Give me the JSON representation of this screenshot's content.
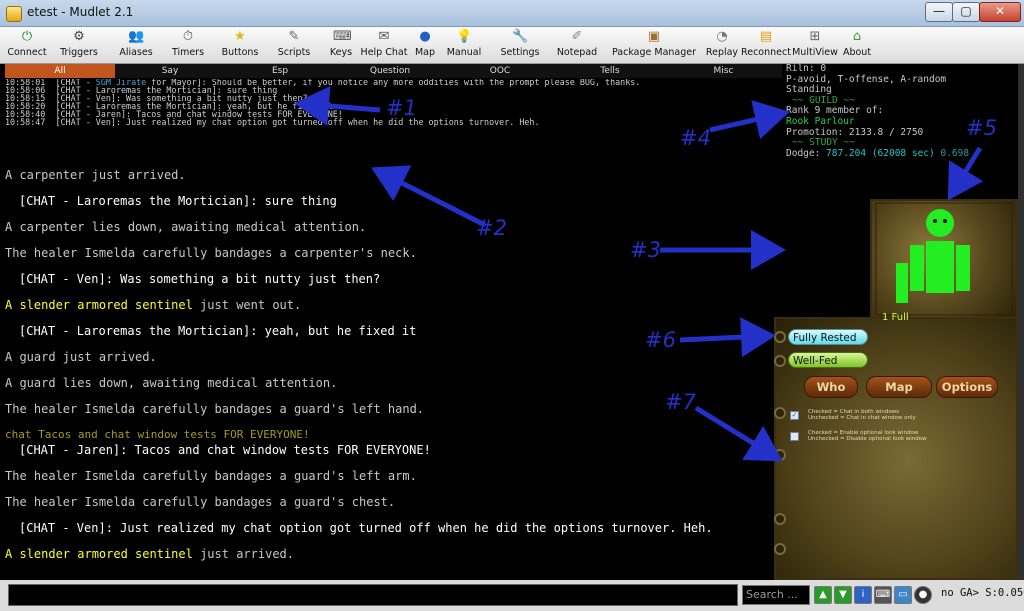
{
  "window": {
    "title": "etest - Mudlet 2.1",
    "controls": [
      "—",
      "▢",
      "✕"
    ]
  },
  "toolbar": [
    {
      "label": "Connect",
      "icon": "connect-icon"
    },
    {
      "label": "Triggers",
      "icon": "triggers-icon"
    },
    {
      "label": "Aliases",
      "icon": "aliases-icon"
    },
    {
      "label": "Timers",
      "icon": "timers-icon"
    },
    {
      "label": "Buttons",
      "icon": "buttons-icon"
    },
    {
      "label": "Scripts",
      "icon": "scripts-icon"
    },
    {
      "label": "Keys",
      "icon": "keys-icon"
    },
    {
      "label": "Help Chat",
      "icon": "help-chat-icon"
    },
    {
      "label": "Map",
      "icon": "map-icon"
    },
    {
      "label": "Manual",
      "icon": "manual-icon"
    },
    {
      "label": "Settings",
      "icon": "settings-icon"
    },
    {
      "label": "Notepad",
      "icon": "notepad-icon"
    },
    {
      "label": "Package Manager",
      "icon": "package-manager-icon"
    },
    {
      "label": "Replay",
      "icon": "replay-icon"
    },
    {
      "label": "Reconnect",
      "icon": "reconnect-icon"
    },
    {
      "label": "MultiView",
      "icon": "multiview-icon"
    },
    {
      "label": "About",
      "icon": "about-icon"
    }
  ],
  "chat_tabs": [
    "All",
    "Say",
    "Esp",
    "Question",
    "OOC",
    "Tells",
    "Misc"
  ],
  "chat_lines": [
    {
      "time": "10:58:01",
      "pre": "[CHAT - ",
      "hl": "SGM Jirate",
      "post": " for Mayor]: Should be better, if you notice any more oddities with the prompt please BUG, thanks."
    },
    {
      "time": "10:58:06",
      "pre": "[CHAT - Laroremas the Mortician]: sure thing",
      "hl": "",
      "post": ""
    },
    {
      "time": "10:58:15",
      "pre": "[CHAT - Ven]: Was something a bit nutty just then?",
      "hl": "",
      "post": ""
    },
    {
      "time": "10:58:20",
      "pre": "[CHAT - Laroremas the Mortician]: yeah, but he fixed it",
      "hl": "",
      "post": ""
    },
    {
      "time": "10:58:40",
      "pre": "[CHAT - Jaren]: Tacos and chat window tests FOR EVERYONE!",
      "hl": "",
      "post": ""
    },
    {
      "time": "10:58:47",
      "pre": "[CHAT - Ven]: Just realized my chat option got turned off when he did the options turnover. Heh.",
      "hl": "",
      "post": ""
    }
  ],
  "main_lines": [
    {
      "text": "A carpenter just arrived.",
      "style": "plain"
    },
    {
      "text": "[CHAT - Laroremas the Mortician]: sure thing",
      "style": "chat"
    },
    {
      "text": "A carpenter lies down, awaiting medical attention.",
      "style": "plain"
    },
    {
      "text": "The healer Ismelda carefully bandages a carpenter's neck.",
      "style": "plain"
    },
    {
      "text": "[CHAT - Ven]: Was something a bit nutty just then?",
      "style": "chat"
    },
    {
      "text": "A slender armored sentinel",
      "rest": " just went out.",
      "style": "yellow"
    },
    {
      "text": "[CHAT - Laroremas the Mortician]: yeah, but he fixed it",
      "style": "chat"
    },
    {
      "text": "A guard just arrived.",
      "style": "plain"
    },
    {
      "text": "A guard lies down, awaiting medical attention.",
      "style": "plain"
    },
    {
      "text": "The healer Ismelda carefully bandages a guard's left hand.",
      "style": "plain"
    },
    {
      "text": "chat Tacos and chat window tests FOR EVERYONE!",
      "style": "olive"
    },
    {
      "text": "[CHAT - Jaren]: Tacos and chat window tests FOR EVERYONE!",
      "style": "chat"
    },
    {
      "text": "The healer Ismelda carefully bandages a guard's left arm.",
      "style": "plain"
    },
    {
      "text": "The healer Ismelda carefully bandages a guard's chest.",
      "style": "plain"
    },
    {
      "text": "[CHAT - Ven]: Just realized my chat option got turned off when he did the options turnover. Heh.",
      "style": "chat"
    },
    {
      "text": "A slender armored sentinel",
      "rest": " just arrived.",
      "style": "yellow"
    }
  ],
  "stats": {
    "riln": "Riln: 0",
    "modes": "P-avoid, T-offense, A-random",
    "stance": "Standing",
    "guild_header": "~~ GUILD ~~",
    "rank": "Rank 9 member of:",
    "guild_name": "Rook Parlour",
    "promotion": "Promotion: 2133.8 / 2750",
    "study_header": "~~ STUDY ~~",
    "dodge_label": "Dodge: ",
    "dodge_value": "787.204",
    "dodge_sec": "(62008 sec)",
    "dodge_rate": "0.698"
  },
  "map": {
    "player": "@",
    "other": "*"
  },
  "body": {
    "status": "1 Full",
    "color": "#22ee22"
  },
  "status_bars": {
    "rest": "Fully Rested",
    "fed": "Well-Fed"
  },
  "panel_buttons": [
    "Who",
    "Map",
    "Options"
  ],
  "options": [
    {
      "line1": "Checked = Chat in both windows",
      "line2": "Unchecked = Chat in chat window only"
    },
    {
      "line1": "Checked = Enable optional look window",
      "line2": "Unchecked = Disable optional look window"
    }
  ],
  "command_bar": {
    "search_placeholder": "Search ...",
    "status": "no GA> S:0.050"
  },
  "annotations": [
    "#1",
    "#2",
    "#3",
    "#4",
    "#5",
    "#6",
    "#7"
  ],
  "colors": {
    "annotation": "#2331c8",
    "active_tab": "#c0561e",
    "sentinel": "#ffff2a",
    "body": "#22ee22"
  }
}
